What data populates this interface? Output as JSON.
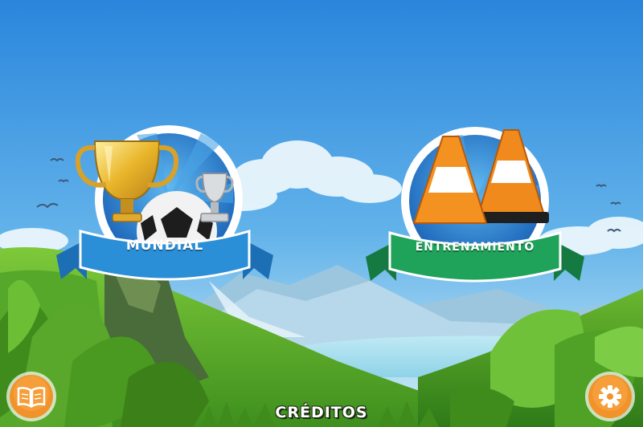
{
  "modes": {
    "mundial_label": "MUNDIAL",
    "entrenamiento_label": "ENTRENAMIENTO"
  },
  "footer": {
    "credits_label": "CRÉDITOS"
  },
  "icons": {
    "left_button": "book-icon",
    "right_button": "gear-icon"
  },
  "colors": {
    "sky_top": "#2f8ee0",
    "sky_bottom": "#bfe6f6",
    "ribbon_blue": "#2a8fd6",
    "ribbon_green": "#1fa25a",
    "button_orange": "#f2922b"
  }
}
